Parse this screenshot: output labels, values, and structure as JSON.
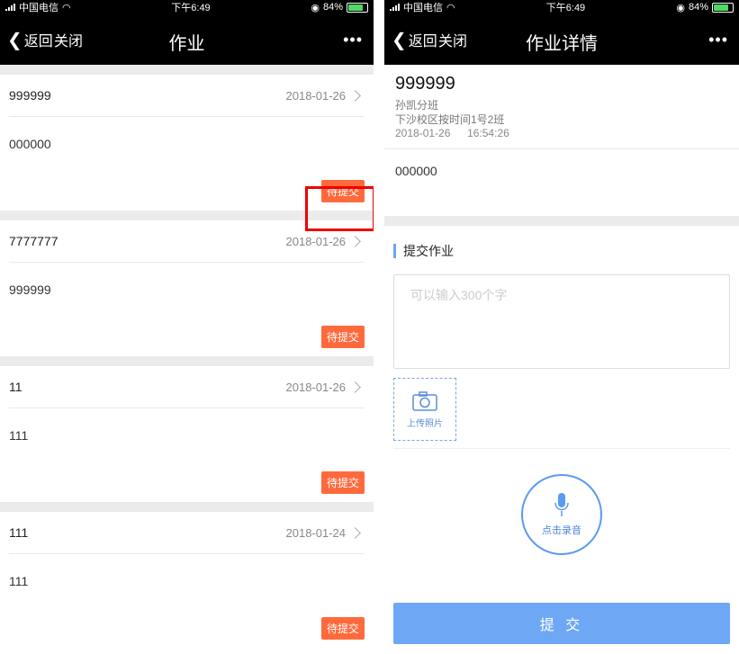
{
  "status": {
    "carrier": "中国电信",
    "time": "下午6:49",
    "battery": "84%"
  },
  "left": {
    "nav": {
      "back_label": "返回",
      "close_label": "关闭",
      "title": "作业",
      "more": "•••"
    },
    "items": [
      {
        "title": "999999",
        "date": "2018-01-26",
        "content": "000000",
        "status": "待提交"
      },
      {
        "title": "7777777",
        "date": "2018-01-26",
        "content": "999999",
        "status": "待提交"
      },
      {
        "title": "11",
        "date": "2018-01-26",
        "content": "111",
        "status": "待提交"
      },
      {
        "title": "111",
        "date": "2018-01-24",
        "content": "111",
        "status": "待提交"
      }
    ]
  },
  "right": {
    "nav": {
      "back_label": "返回",
      "close_label": "关闭",
      "title": "作业详情",
      "more": "•••"
    },
    "detail": {
      "title": "999999",
      "teacher_class": "孙凯分班",
      "campus_class": "下沙校区按时间1号2班",
      "date": "2018-01-26",
      "time": "16:54:26",
      "content": "000000"
    },
    "submit_section": {
      "title": "提交作业",
      "placeholder": "可以输入300个字",
      "upload_label": "上传照片",
      "record_label": "点击录音",
      "submit_label": "提 交"
    }
  },
  "colors": {
    "badge": "#ff6a3d",
    "accent": "#6ea8f5",
    "highlight": "#e00000"
  }
}
